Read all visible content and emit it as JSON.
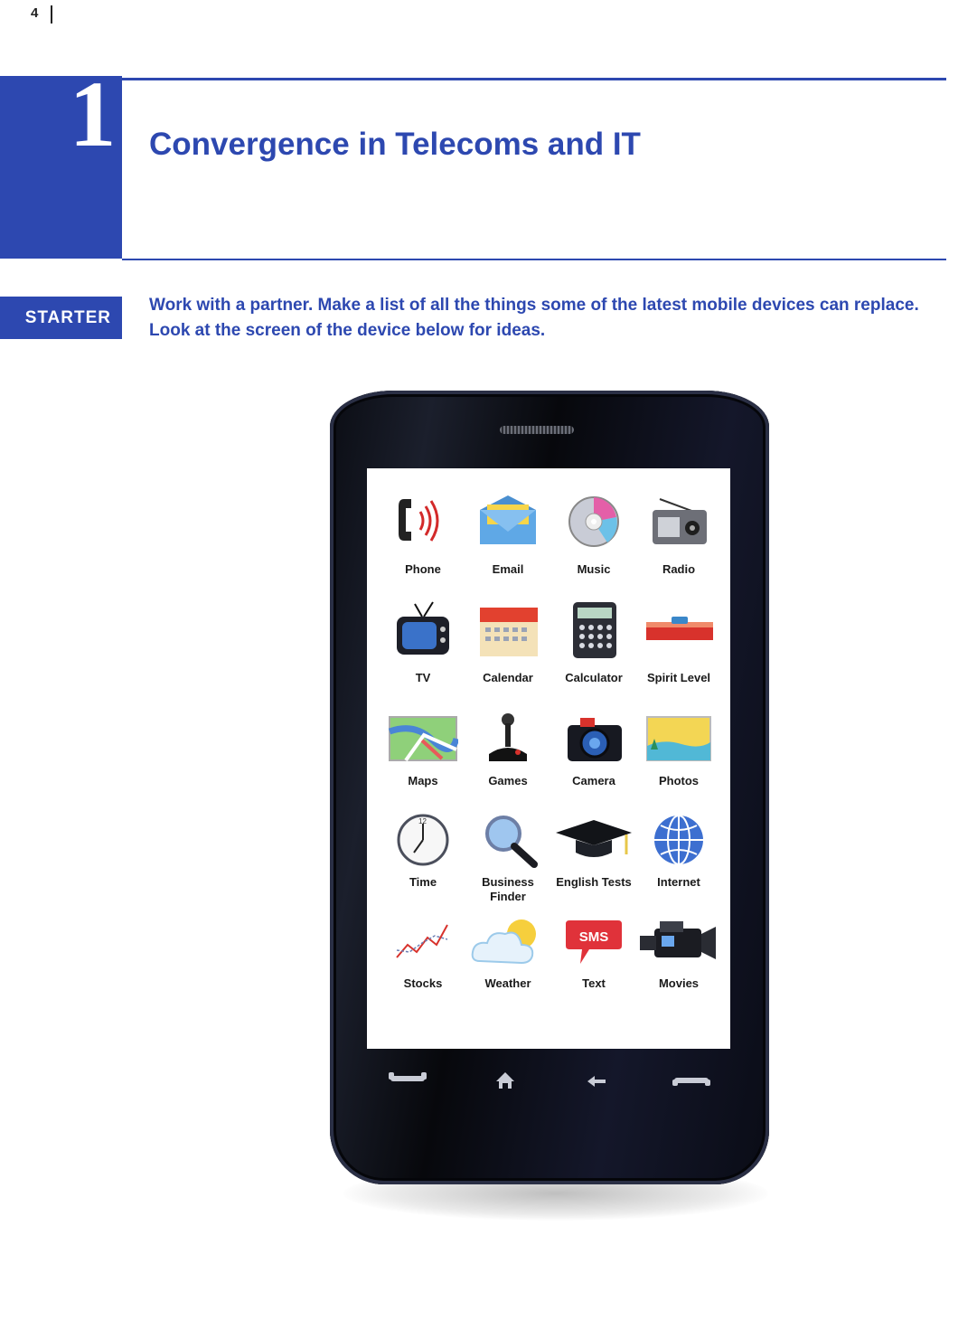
{
  "page": {
    "number": "4"
  },
  "unit": {
    "number": "1",
    "title": "Convergence in Telecoms and IT"
  },
  "starter": {
    "label": "STARTER",
    "line1": "Work with a partner. Make a list of all the things some of the latest mobile devices can replace.",
    "line2": "Look at the screen of the device below for ideas."
  },
  "phone": {
    "apps": [
      {
        "label": "Phone",
        "icon": "phone-icon"
      },
      {
        "label": "Email",
        "icon": "email-icon"
      },
      {
        "label": "Music",
        "icon": "music-cd-icon"
      },
      {
        "label": "Radio",
        "icon": "radio-icon"
      },
      {
        "label": "TV",
        "icon": "tv-icon"
      },
      {
        "label": "Calendar",
        "icon": "calendar-icon"
      },
      {
        "label": "Calculator",
        "icon": "calculator-icon"
      },
      {
        "label": "Spirit Level",
        "icon": "spirit-level-icon"
      },
      {
        "label": "Maps",
        "icon": "map-icon"
      },
      {
        "label": "Games",
        "icon": "joystick-icon"
      },
      {
        "label": "Camera",
        "icon": "camera-icon"
      },
      {
        "label": "Photos",
        "icon": "photo-icon"
      },
      {
        "label": "Time",
        "icon": "clock-icon"
      },
      {
        "label": "Business\nFinder",
        "icon": "magnifier-icon"
      },
      {
        "label": "English Tests",
        "icon": "graduation-cap-icon"
      },
      {
        "label": "Internet",
        "icon": "globe-icon"
      },
      {
        "label": "Stocks",
        "icon": "stocks-chart-icon"
      },
      {
        "label": "Weather",
        "icon": "weather-icon"
      },
      {
        "label": "Text",
        "icon": "sms-bubble-icon"
      },
      {
        "label": "Movies",
        "icon": "video-camera-icon"
      }
    ],
    "sms_badge": "SMS",
    "nav": [
      "call-icon",
      "home-icon",
      "back-icon",
      "end-call-icon"
    ]
  },
  "colors": {
    "brand_blue": "#2d48b0"
  }
}
